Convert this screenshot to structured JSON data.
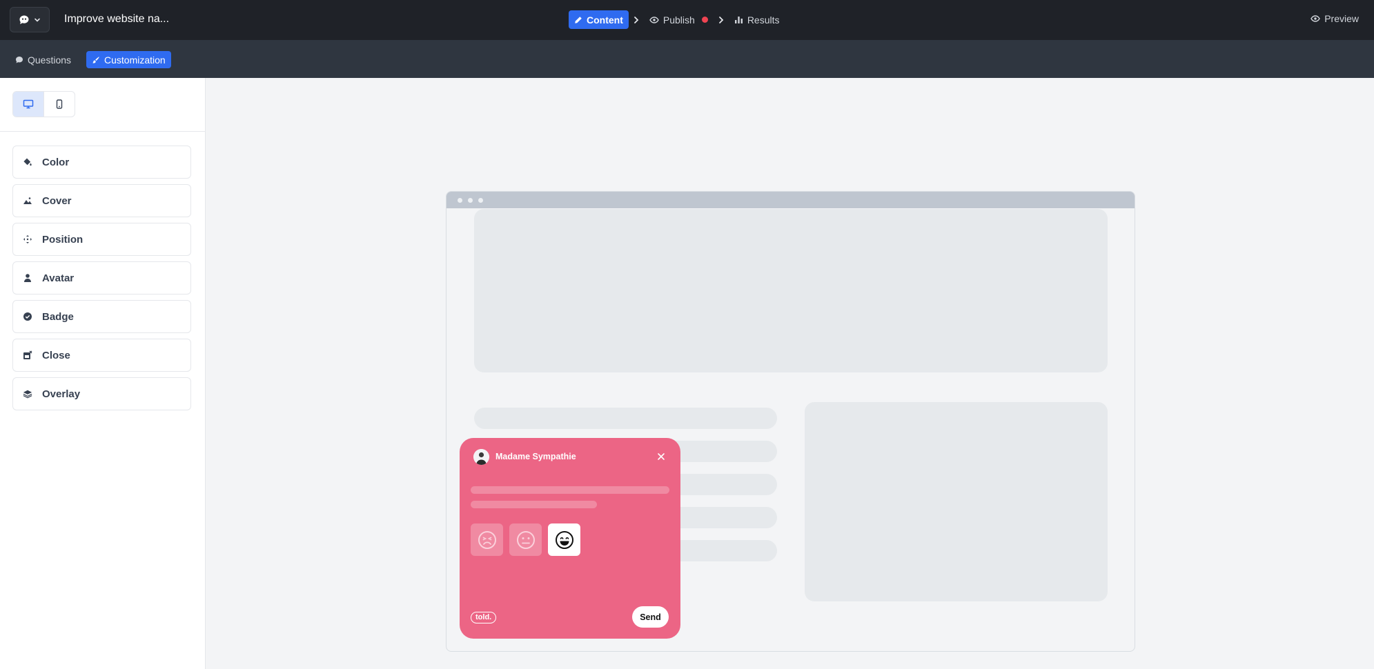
{
  "header": {
    "document_title": "Improve website na...",
    "steps": [
      {
        "label": "Content",
        "active": true
      },
      {
        "label": "Publish",
        "active": false,
        "has_alert": true
      },
      {
        "label": "Results",
        "active": false
      }
    ],
    "preview_label": "Preview"
  },
  "subnav": {
    "tabs": [
      {
        "label": "Questions",
        "active": false
      },
      {
        "label": "Customization",
        "active": true
      }
    ]
  },
  "sidebar": {
    "device_modes": [
      "desktop",
      "mobile"
    ],
    "selected_device": "desktop",
    "items": [
      {
        "label": "Color",
        "icon": "paint-bucket-icon"
      },
      {
        "label": "Cover",
        "icon": "mountain-image-icon"
      },
      {
        "label": "Position",
        "icon": "move-arrows-icon"
      },
      {
        "label": "Avatar",
        "icon": "user-icon"
      },
      {
        "label": "Badge",
        "icon": "badge-check-icon"
      },
      {
        "label": "Close",
        "icon": "close-window-icon"
      },
      {
        "label": "Overlay",
        "icon": "layers-icon"
      }
    ]
  },
  "widget": {
    "author_name": "Madame Sympathie",
    "brand_label": "told.",
    "send_label": "Send",
    "emoji_options": [
      "sad-face-icon",
      "neutral-face-icon",
      "happy-face-icon"
    ],
    "selected_emoji": "happy-face-icon"
  },
  "colors": {
    "topbar": "#1f2228",
    "subbar": "#2f3640",
    "accent": "#2f6bf0",
    "widget": "#ec6585",
    "alert_dot": "#ef4452"
  }
}
